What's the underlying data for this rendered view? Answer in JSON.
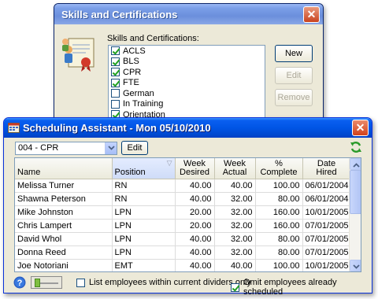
{
  "skills_window": {
    "title": "Skills and Certifications",
    "list_label": "Skills and Certifications:",
    "skills": [
      {
        "label": "ACLS",
        "checked": true
      },
      {
        "label": "BLS",
        "checked": true
      },
      {
        "label": "CPR",
        "checked": true
      },
      {
        "label": "FTE",
        "checked": true
      },
      {
        "label": "German",
        "checked": false
      },
      {
        "label": "In Training",
        "checked": false
      },
      {
        "label": "Orientation",
        "checked": true
      }
    ],
    "buttons": {
      "new": "New",
      "edit": "Edit",
      "remove": "Remove"
    }
  },
  "scheduling_window": {
    "title": "Scheduling Assistant - Mon  05/10/2010",
    "combo_value": "004 - CPR",
    "edit_button": "Edit",
    "columns": [
      "Name",
      "Position",
      "Week Desired",
      "Week Actual",
      "% Complete",
      "Date Hired"
    ],
    "header_lines": [
      [
        "",
        "Name"
      ],
      [
        "",
        "Position"
      ],
      [
        "Week",
        "Desired"
      ],
      [
        "Week",
        "Actual"
      ],
      [
        "%",
        "Complete"
      ],
      [
        "Date",
        "Hired"
      ]
    ],
    "rows": [
      [
        "Melissa Turner",
        "RN",
        "40.00",
        "40.00",
        "100.00",
        "06/01/2004"
      ],
      [
        "Shawna Peterson",
        "RN",
        "40.00",
        "32.00",
        "80.00",
        "06/01/2004"
      ],
      [
        "Mike Johnston",
        "LPN",
        "20.00",
        "32.00",
        "160.00",
        "10/01/2005"
      ],
      [
        "Chris Lampert",
        "LPN",
        "20.00",
        "32.00",
        "160.00",
        "07/01/2005"
      ],
      [
        "David Whol",
        "LPN",
        "40.00",
        "32.00",
        "80.00",
        "07/01/2005"
      ],
      [
        "Donna Reed",
        "LPN",
        "40.00",
        "32.00",
        "80.00",
        "07/01/2005"
      ],
      [
        "Joe Notoriani",
        "EMT",
        "40.00",
        "40.00",
        "100.00",
        "10/01/2005"
      ]
    ],
    "options": {
      "list_within_dividers": {
        "label": "List employees within current dividers only",
        "checked": false
      },
      "omit_scheduled": {
        "label": "Omit employees already scheduled",
        "checked": true
      }
    }
  },
  "colors": {
    "xp_title_blue": "#0055e5",
    "inactive_title_blue": "#7b9fe8",
    "close_red": "#d1421b",
    "window_face": "#ece9d8",
    "check_green": "#21a121"
  },
  "icons": [
    "certificate-icon",
    "app-icon",
    "close-icon",
    "dropdown-arrow-icon",
    "refresh-icon",
    "help-icon",
    "sort-icon",
    "scroll-up-icon",
    "scroll-down-icon"
  ]
}
